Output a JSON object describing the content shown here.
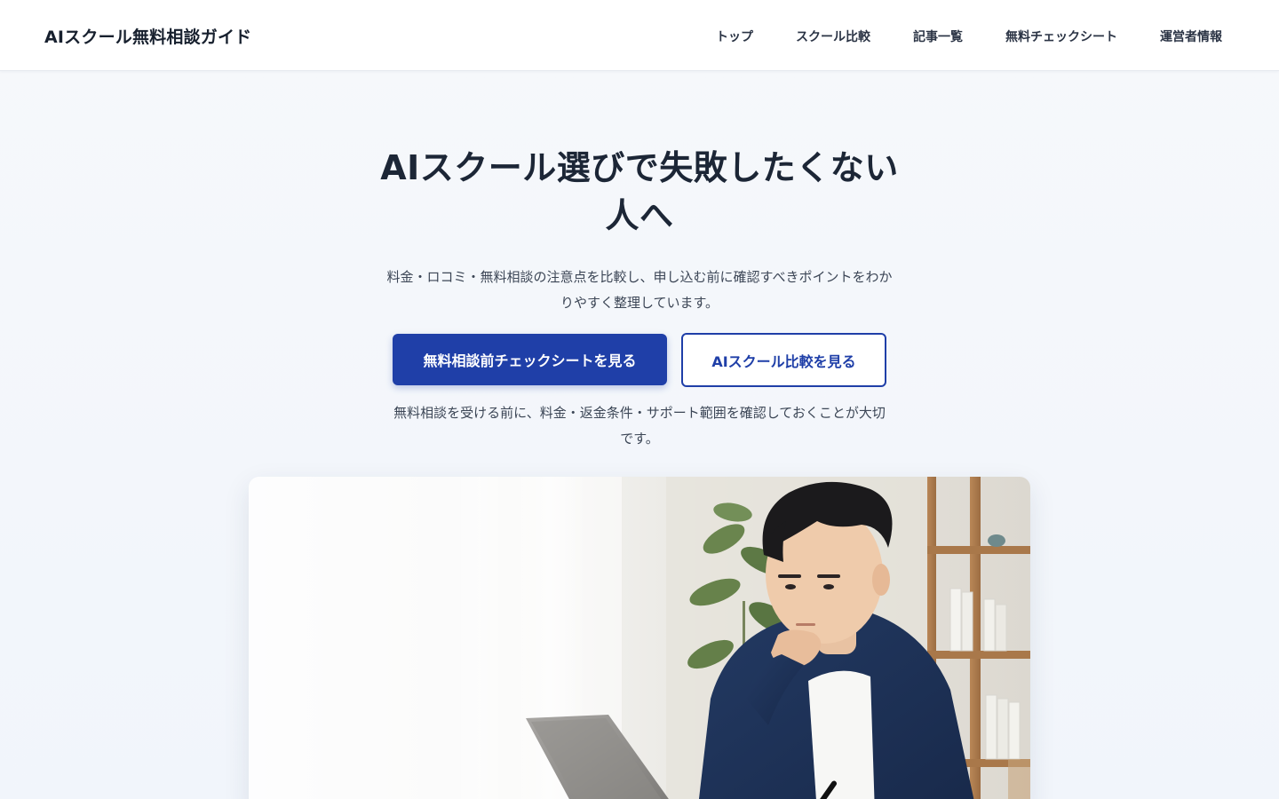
{
  "header": {
    "logo": "AIスクール無料相談ガイド",
    "nav": [
      {
        "label": "トップ"
      },
      {
        "label": "スクール比較"
      },
      {
        "label": "記事一覧"
      },
      {
        "label": "無料チェックシート"
      },
      {
        "label": "運営者情報"
      }
    ]
  },
  "hero": {
    "title_line1": "AIスクール選びで失敗したくない",
    "title_line2": "人へ",
    "subtitle_line1": "料金・ロコミ・無料相談の注意点を比較し、申し込む前に確認すべきポイントをわか",
    "subtitle_line2": "りやすく整理しています。",
    "primary_button": "無料相談前チェックシートを見る",
    "secondary_button": "AIスクール比較を見る",
    "note_line1": "無料相談を受ける前に、料金・返金条件・サポート範囲を確認しておくことが大切",
    "note_line2": "です。"
  },
  "colors": {
    "accent": "#1f3fa8",
    "text_dark": "#1c2636",
    "background": "#f4f7fb"
  },
  "icons": {
    "hero_image": "man-thinking-at-laptop-photo"
  }
}
